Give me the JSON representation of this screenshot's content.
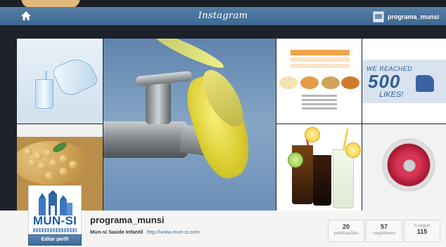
{
  "header": {
    "brand": "Instagram",
    "username": "programa_munsi",
    "home_icon": "home-icon",
    "bar_color": "#4a7399"
  },
  "grid": {
    "tiles": [
      {
        "subject": "water-pour-photo"
      },
      {
        "subject": "chickpeas-photo"
      },
      {
        "subject": "bird-on-faucet-photo"
      },
      {
        "subject": "nutrition-info-photo"
      },
      {
        "subject": "500-likes-photo",
        "text_top": "WE REACHED",
        "text_num": "500",
        "text_bottom": "LIKES!"
      },
      {
        "subject": "iced-drinks-photo"
      },
      {
        "subject": "blender-photo"
      }
    ]
  },
  "profile": {
    "avatar_wordmark": "MUN-SI",
    "edit_label": "Editar perfil",
    "username": "programa_munsi",
    "bio_name": "Mun-si Saúde Infantil",
    "bio_link": "http://www.mun-si.com"
  },
  "stats": {
    "posts": {
      "value": "20",
      "label": "publicações"
    },
    "followers": {
      "value": "57",
      "label": "seguidores"
    },
    "following": {
      "label": "A seguir",
      "value": "115"
    }
  }
}
